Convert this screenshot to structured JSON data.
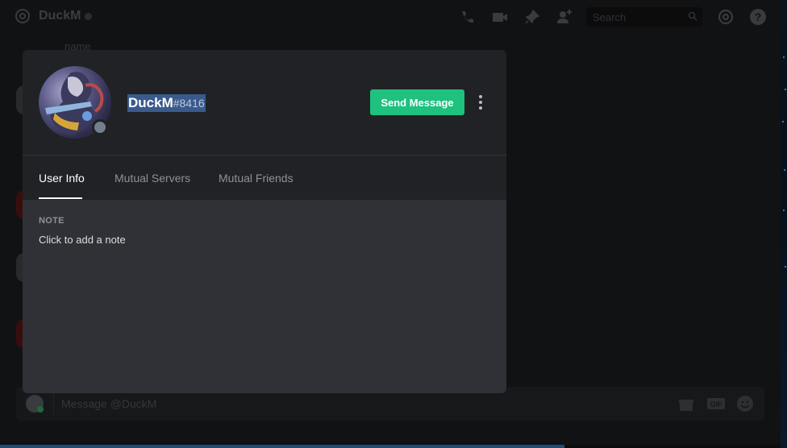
{
  "background": {
    "channel_title": "DuckM",
    "search_placeholder": "Search",
    "partial_name": "name",
    "composer_placeholder": "Message @DuckM",
    "composer_gif": "GIF"
  },
  "profile": {
    "username": "DuckM",
    "discriminator": "#8416",
    "status": "offline",
    "send_message_label": "Send Message",
    "tabs": [
      {
        "label": "User Info",
        "active": true
      },
      {
        "label": "Mutual Servers",
        "active": false
      },
      {
        "label": "Mutual Friends",
        "active": false
      }
    ],
    "note_label": "NOTE",
    "note_placeholder": "Click to add a note"
  },
  "colors": {
    "accent_green": "#1fc17e",
    "modal_bg": "#2f3136",
    "header_bg": "#202225",
    "selection": "#3a5a8c",
    "status_offline": "#747f8d"
  },
  "icons": {
    "topbar": [
      "at-icon",
      "call-icon",
      "video-icon",
      "pin-icon",
      "add-friend-icon",
      "search-icon",
      "mention-icon",
      "help-icon"
    ],
    "composer": [
      "attach-plus-icon",
      "gift-icon",
      "gif-icon",
      "emoji-icon"
    ],
    "header": [
      "more-options-icon"
    ]
  }
}
